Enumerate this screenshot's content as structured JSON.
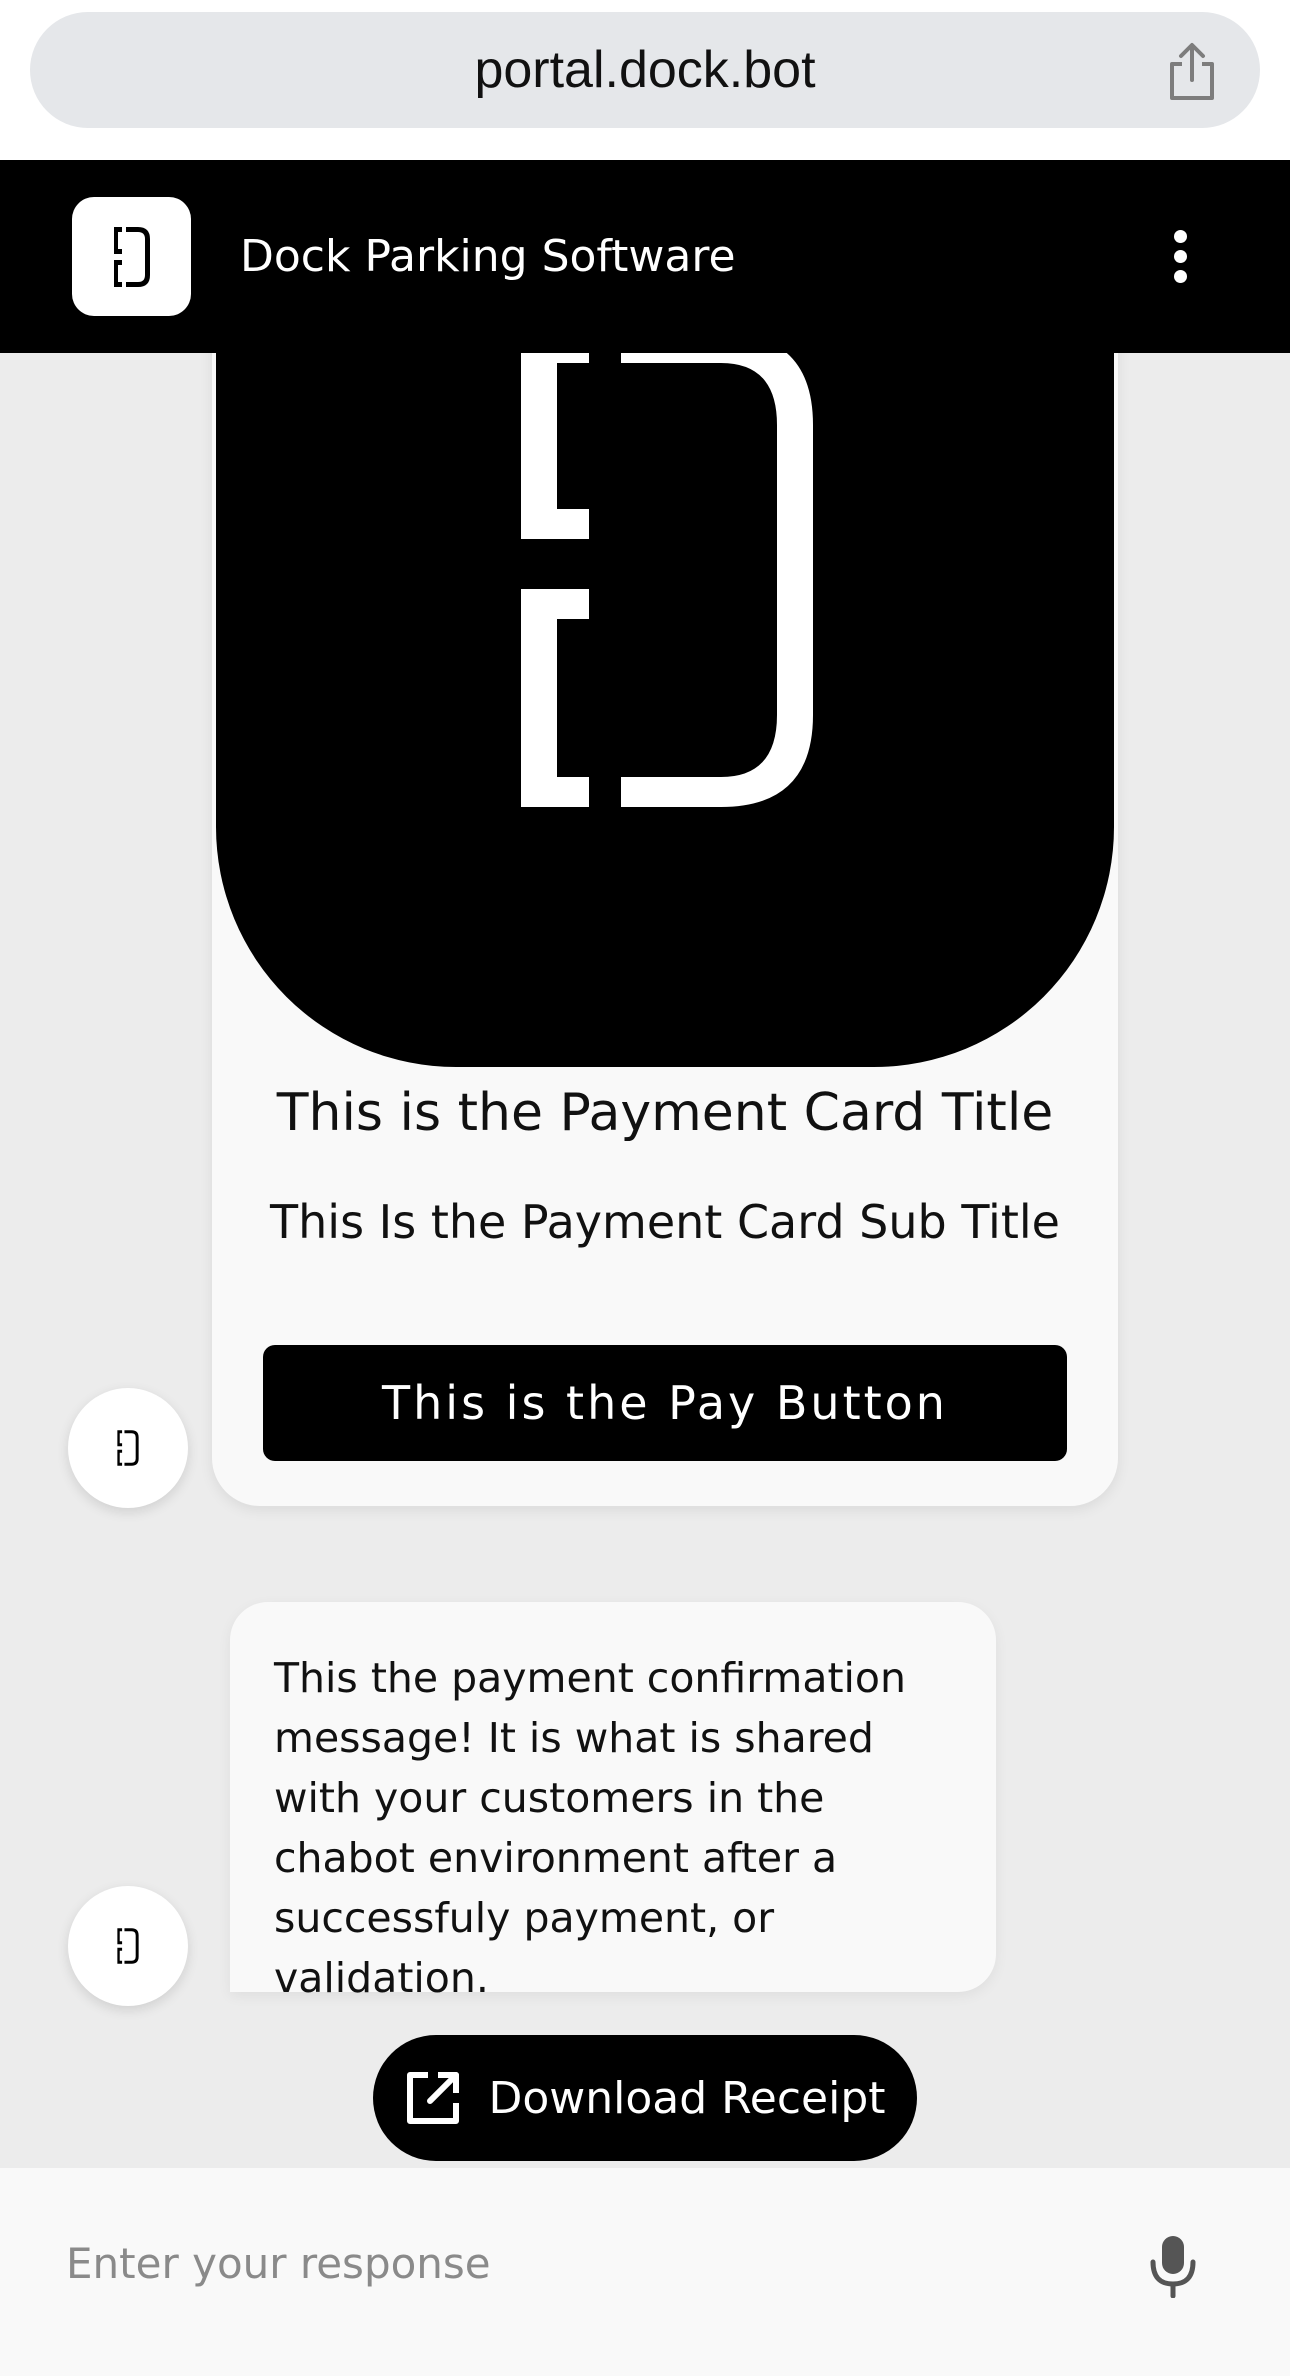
{
  "browser": {
    "url": "portal.dock.bot",
    "share_icon": "share-icon"
  },
  "header": {
    "title": "Dock Parking Software",
    "logo_icon": "dock-logo-icon",
    "menu_icon": "kebab-menu-icon"
  },
  "payment_card": {
    "title": "This is the Payment Card Title",
    "subtitle": "This Is the Payment Card Sub Title",
    "pay_button_label": "This is the Pay Button"
  },
  "confirmation_message": {
    "text": "This the payment confirmation message! It is what is shared with your customers in the chabot environment after a successfuly payment, or validation."
  },
  "download_button": {
    "label": "Download Receipt",
    "icon": "external-link-icon"
  },
  "input": {
    "placeholder": "Enter your response",
    "mic_icon": "microphone-icon"
  },
  "colors": {
    "primary": "#000000",
    "background": "#ececec",
    "card": "#f9f9f9",
    "url_bar": "#e5e7ea"
  }
}
